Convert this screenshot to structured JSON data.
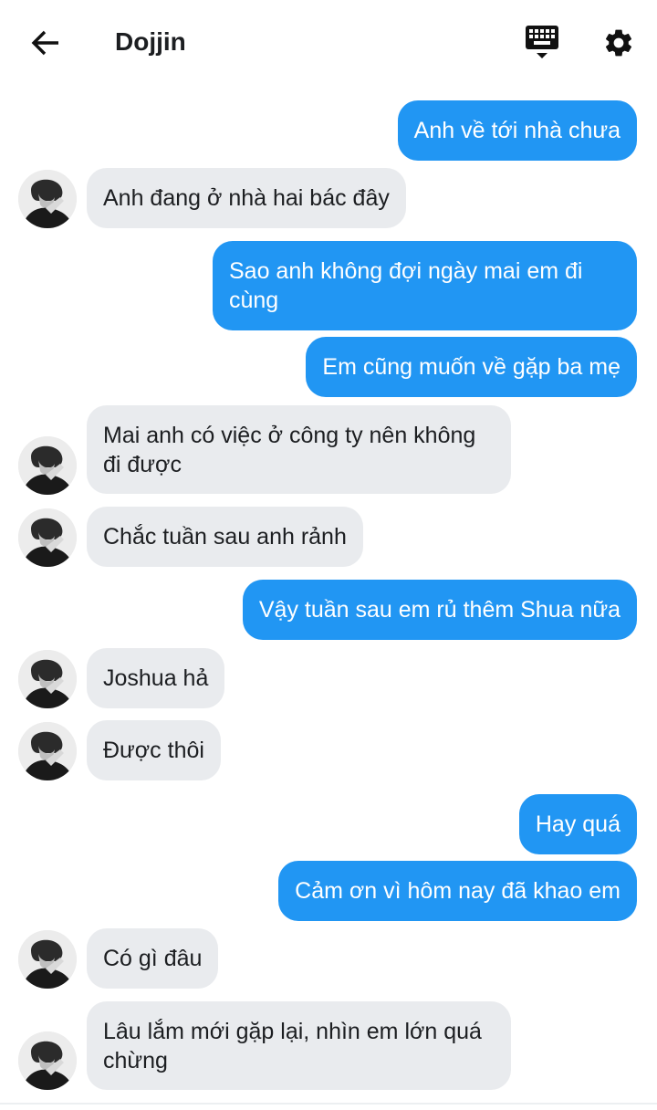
{
  "header": {
    "title": "Dojjin",
    "back_icon": "arrow-left-icon",
    "keyboard_icon": "keyboard-icon",
    "settings_icon": "gear-icon"
  },
  "colors": {
    "outgoing_bubble": "#2196f3",
    "incoming_bubble": "#e9ebee",
    "text_dark": "#1c1e21"
  },
  "messages": [
    {
      "side": "out",
      "text": "Anh về tới nhà chưa"
    },
    {
      "side": "in",
      "text": "Anh đang ở nhà hai bác đây"
    },
    {
      "side": "out",
      "text": "Sao anh không đợi ngày mai em đi cùng"
    },
    {
      "side": "out",
      "text": "Em cũng muốn về gặp ba mẹ"
    },
    {
      "side": "in",
      "text": "Mai anh có việc ở công ty nên không đi được"
    },
    {
      "side": "in",
      "text": "Chắc tuần sau anh rảnh"
    },
    {
      "side": "out",
      "text": "Vậy tuần sau em rủ thêm Shua nữa"
    },
    {
      "side": "in",
      "text": "Joshua hả"
    },
    {
      "side": "in",
      "text": "Được thôi"
    },
    {
      "side": "out",
      "text": "Hay quá"
    },
    {
      "side": "out",
      "text": "Cảm ơn vì hôm nay đã khao em"
    },
    {
      "side": "in",
      "text": "Có gì đâu"
    },
    {
      "side": "in",
      "text": "Lâu lắm mới gặp lại, nhìn em lớn quá chừng"
    }
  ]
}
